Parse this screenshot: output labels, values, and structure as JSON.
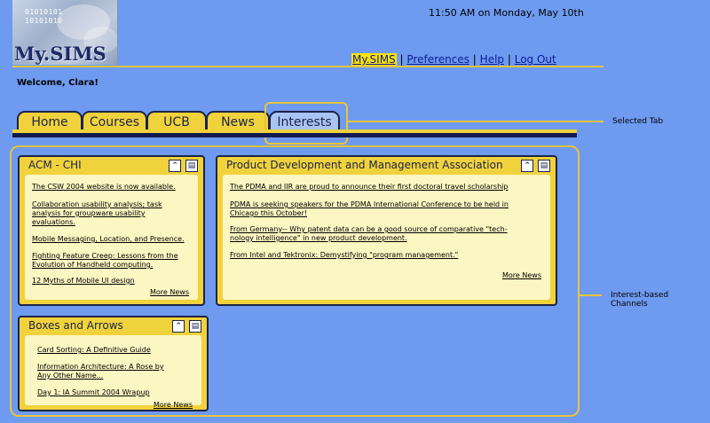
{
  "logo": {
    "text": "My.SIMS",
    "binary_line1": "01010101",
    "binary_line2": "10101010"
  },
  "datetime": "11:50 AM on Monday, May 10th",
  "top_links": [
    {
      "label": "My.SIMS"
    },
    {
      "label": "Preferences"
    },
    {
      "label": "Help"
    },
    {
      "label": "Log Out"
    }
  ],
  "separator": "|",
  "welcome": "Welcome, Clara!",
  "tabs": [
    {
      "label": "Home"
    },
    {
      "label": "Courses"
    },
    {
      "label": "UCB"
    },
    {
      "label": "News"
    },
    {
      "label": "Interests",
      "selected": true
    }
  ],
  "callouts": {
    "selected_tab": "Selected Tab",
    "channels_line1": "Interest-based",
    "channels_line2": "Channels"
  },
  "channel_icons": {
    "collapse": "collapse-up-icon",
    "remove": "trash-icon"
  },
  "channels": {
    "acm": {
      "title": "ACM - CHI",
      "items": [
        "The CSW 2004 website is now available.",
        "Collaboration usability analysis; task",
        "analysis for groupware usability",
        "evaluations.",
        "Mobile Messaging, Location, and Presence.",
        "Fighting Feature Creep:  Lessons from the",
        "Evolution of Handheld computing.",
        "12 Myths of Mobile UI design"
      ],
      "more": "More News"
    },
    "pdma": {
      "title": "Product Development and Management Association",
      "items": [
        "The PDMA and IIR are proud to announce their first doctoral travel scholarship",
        "PDMA is seeking speakers for the PDMA International Conference to be held in",
        "Chicago this October!",
        "From Germany-- Why patent data can be a good source of comparative \"tech-",
        "nology intelligence\" in new product development.",
        "From Intel and Tektronix:  Demystifying \"program management.\""
      ],
      "more": "More News"
    },
    "boxes": {
      "title": "Boxes and Arrows",
      "items": [
        "Card Sorting: A Definitive Guide",
        "Information Architecture: A Rose by",
        "Any Other Name...",
        "Day 1: IA Summit 2004 Wrapup"
      ],
      "more": "More News"
    }
  },
  "colors": {
    "background": "#6e9bf0",
    "tab_yellow": "#f0d23c",
    "navy": "#1c2348",
    "highlight": "#ffe400"
  }
}
